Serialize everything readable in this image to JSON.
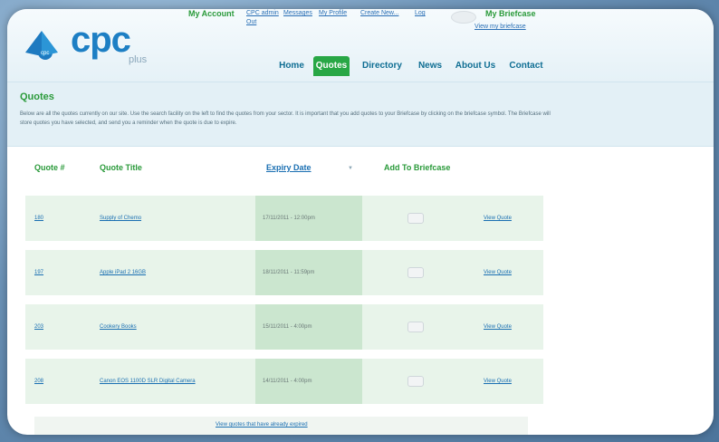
{
  "header": {
    "logo_text": "cpc",
    "logo_sub": "plus",
    "logo_badge": "cpc",
    "my_account_label": "My Account",
    "account_links": [
      "CPC admin",
      "Messages",
      "My Profile",
      "Create New...",
      "Log"
    ],
    "account_extra": "Out",
    "briefcase_label": "My Briefcase",
    "briefcase_link": "View my briefcase"
  },
  "nav": {
    "items": [
      "Home",
      "Quotes",
      "Directory",
      "News",
      "About Us",
      "Contact"
    ],
    "active": "Quotes"
  },
  "page": {
    "title": "Quotes",
    "intro": "Below are all the quotes currently on our site. Use the search facility on the left to find the quotes from your sector. It is important that you add quotes to your Briefcase by clicking on the briefcase symbol. The Briefcase will store quotes you have selected, and send you a reminder when the quote is due to expire."
  },
  "table": {
    "headers": {
      "num": "Quote #",
      "title": "Quote Title",
      "expiry": "Expiry Date",
      "briefcase": "Add To Briefcase"
    },
    "rows": [
      {
        "num": "180",
        "title": "Supply of Chemo",
        "expiry": "17/11/2011 - 12:00pm",
        "view": "View Quote"
      },
      {
        "num": "197",
        "title": "Apple iPad 2 16GB",
        "expiry": "18/11/2011 - 11:59pm",
        "view": "View Quote"
      },
      {
        "num": "203",
        "title": "Cookery Books",
        "expiry": "15/11/2011 - 4:00pm",
        "view": "View Quote"
      },
      {
        "num": "208",
        "title": "Canon EOS 1100D SLR Digital Camera",
        "expiry": "14/11/2011 - 4:00pm",
        "view": "View Quote"
      }
    ]
  },
  "footer": {
    "expired_link": "View quotes that have already expired"
  }
}
